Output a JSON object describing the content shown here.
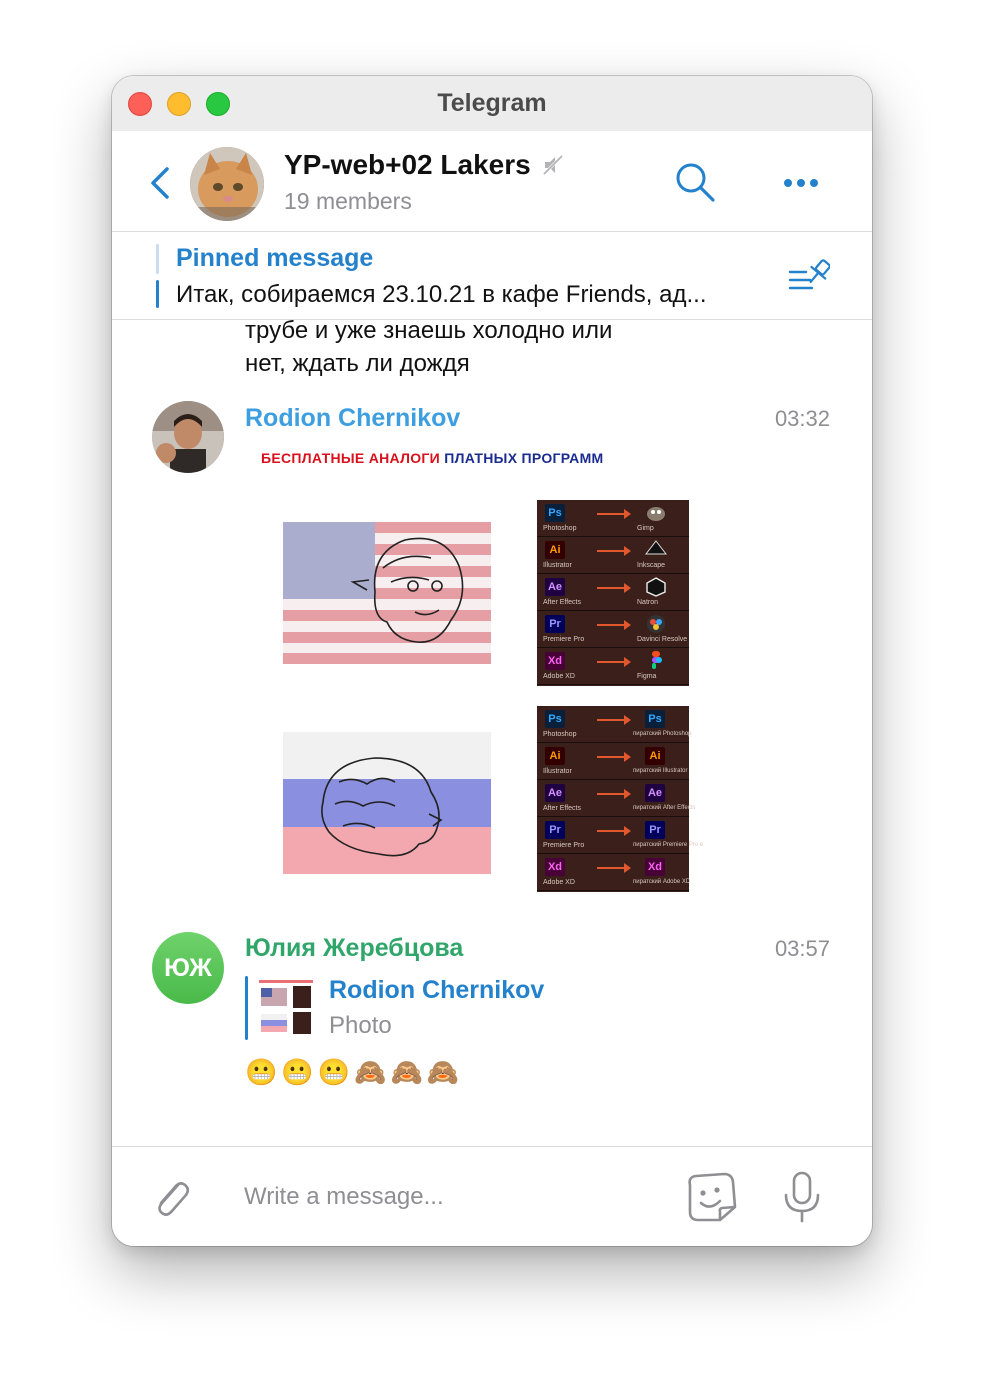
{
  "window": {
    "title": "Telegram"
  },
  "header": {
    "group_name": "YP-web+02 Lakers",
    "members": "19 members",
    "avatar": "cat-photo"
  },
  "pinned": {
    "title": "Pinned message",
    "text": "Итак, собираемся 23.10.21 в кафе Friends, ад..."
  },
  "messages": {
    "previous_text_line1": "трубе и уже знаешь холодно или",
    "previous_text_line2": "нет, ждать ли дождя",
    "msg1": {
      "sender": "Rodion Chernikov",
      "time": "03:32",
      "image": {
        "caption_part1": "БЕСПЛАТНЫЕ АНАЛОГИ",
        "caption_part2": " ПЛАТНЫХ ПРОГРАММ",
        "table_top": [
          {
            "badge": "Ps",
            "label": "Photoshop",
            "right": "Gimp"
          },
          {
            "badge": "Ai",
            "label": "Illustrator",
            "right": "Inkscape"
          },
          {
            "badge": "Ae",
            "label": "After Effects",
            "right": "Natron"
          },
          {
            "badge": "Pr",
            "label": "Premiere Pro",
            "right": "Davinci Resolve"
          },
          {
            "badge": "Xd",
            "label": "Adobe XD",
            "right": "Figma"
          }
        ],
        "table_bottom": [
          {
            "badge": "Ps",
            "label": "Photoshop",
            "right": "пиратский Photoshop"
          },
          {
            "badge": "Ai",
            "label": "Illustrator",
            "right": "пиратский Illustrator"
          },
          {
            "badge": "Ae",
            "label": "After Effects",
            "right": "пиратский After Effects"
          },
          {
            "badge": "Pr",
            "label": "Premiere Pro",
            "right": "пиратский Premiere Pro e"
          },
          {
            "badge": "Xd",
            "label": "Adobe XD",
            "right": "пиратский Adobe XD"
          }
        ]
      }
    },
    "msg2": {
      "sender": "Юлия Жеребцова",
      "initials": "ЮЖ",
      "time": "03:57",
      "reply_name": "Rodion Chernikov",
      "reply_text": "Photo",
      "text": "😬😬😬🙈🙈🙈"
    }
  },
  "composer": {
    "placeholder": "Write a message..."
  },
  "colors": {
    "accent": "#2481cc",
    "sender1": "#3d9ee0",
    "sender2": "#31a66b",
    "avatar_green": "#52be4f"
  }
}
